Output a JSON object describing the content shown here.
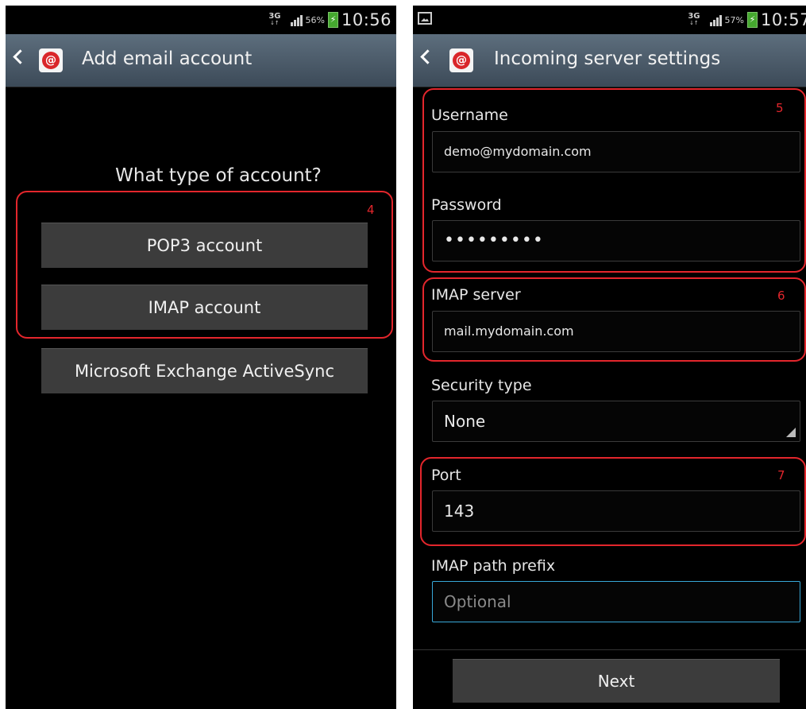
{
  "left": {
    "status": {
      "network": "3G",
      "network_sub": "↓↑",
      "battery_pct": "56%",
      "time": "10:56"
    },
    "actionbar": {
      "title": "Add email account"
    },
    "question": "What type of account?",
    "buttons": [
      "POP3 account",
      "IMAP account",
      "Microsoft Exchange ActiveSync"
    ],
    "annotation": "4"
  },
  "right": {
    "status": {
      "network": "3G",
      "network_sub": "↓↑",
      "battery_pct": "57%",
      "time": "10:57"
    },
    "actionbar": {
      "title": "Incoming server settings"
    },
    "fields": {
      "username": {
        "label": "Username",
        "value": "demo@mydomain.com"
      },
      "password": {
        "label": "Password",
        "value": "•••••••••"
      },
      "imap_server": {
        "label": "IMAP server",
        "value": "mail.mydomain.com"
      },
      "security_type": {
        "label": "Security type",
        "value": "None"
      },
      "port": {
        "label": "Port",
        "value": "143"
      },
      "imap_path_prefix": {
        "label": "IMAP path prefix",
        "placeholder": "Optional"
      }
    },
    "annotations": [
      "5",
      "6",
      "7"
    ],
    "next_label": "Next"
  },
  "colors": {
    "annotation_red": "#e3262c",
    "action_bar": "#4a5968",
    "focus_blue": "#38a8d8"
  }
}
